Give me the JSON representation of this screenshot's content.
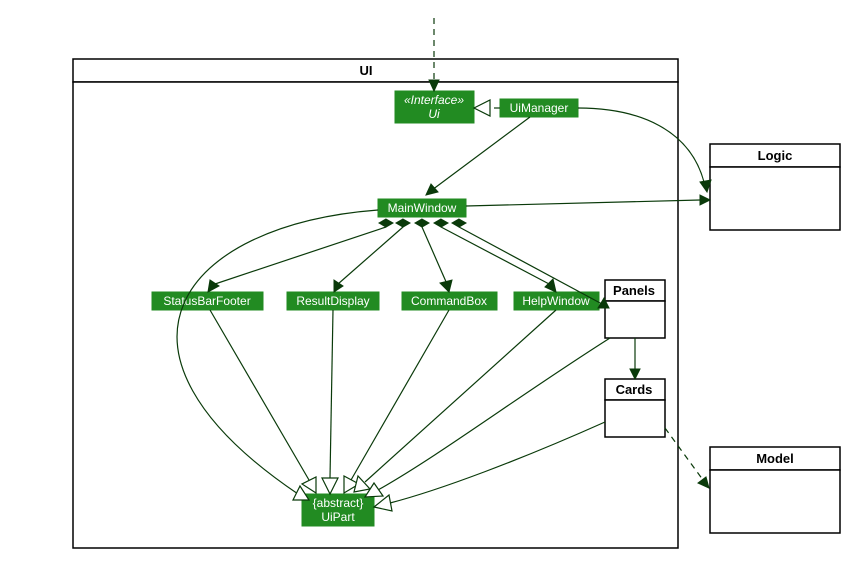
{
  "diagram": {
    "type": "uml-class",
    "packages": {
      "ui": {
        "label": "UI"
      },
      "logic": {
        "label": "Logic"
      },
      "panels": {
        "label": "Panels"
      },
      "cards": {
        "label": "Cards"
      },
      "model": {
        "label": "Model"
      }
    },
    "nodes": {
      "ui_iface": {
        "stereotype": "«Interface»",
        "name": "Ui"
      },
      "uimanager": {
        "name": "UiManager"
      },
      "mainwindow": {
        "name": "MainWindow"
      },
      "statusbarfooter": {
        "name": "StatusBarFooter"
      },
      "resultdisplay": {
        "name": "ResultDisplay"
      },
      "commandbox": {
        "name": "CommandBox"
      },
      "helpwindow": {
        "name": "HelpWindow"
      },
      "uipart": {
        "stereotype": "{abstract}",
        "name": "UiPart"
      }
    },
    "edges": [
      {
        "from": "external",
        "to": "ui_iface",
        "kind": "dependency"
      },
      {
        "from": "uimanager",
        "to": "ui_iface",
        "kind": "realization"
      },
      {
        "from": "uimanager",
        "to": "mainwindow",
        "kind": "association"
      },
      {
        "from": "uimanager",
        "to": "logic",
        "kind": "association"
      },
      {
        "from": "mainwindow",
        "to": "logic",
        "kind": "association"
      },
      {
        "from": "mainwindow",
        "to": "statusbarfooter",
        "kind": "composition"
      },
      {
        "from": "mainwindow",
        "to": "resultdisplay",
        "kind": "composition"
      },
      {
        "from": "mainwindow",
        "to": "commandbox",
        "kind": "composition"
      },
      {
        "from": "mainwindow",
        "to": "helpwindow",
        "kind": "composition"
      },
      {
        "from": "mainwindow",
        "to": "panels",
        "kind": "composition"
      },
      {
        "from": "panels",
        "to": "cards",
        "kind": "association"
      },
      {
        "from": "cards",
        "to": "model",
        "kind": "dependency"
      },
      {
        "from": "mainwindow",
        "to": "uipart",
        "kind": "generalization"
      },
      {
        "from": "statusbarfooter",
        "to": "uipart",
        "kind": "generalization"
      },
      {
        "from": "resultdisplay",
        "to": "uipart",
        "kind": "generalization"
      },
      {
        "from": "commandbox",
        "to": "uipart",
        "kind": "generalization"
      },
      {
        "from": "helpwindow",
        "to": "uipart",
        "kind": "generalization"
      },
      {
        "from": "panels",
        "to": "uipart",
        "kind": "generalization"
      },
      {
        "from": "cards",
        "to": "uipart",
        "kind": "generalization"
      }
    ]
  }
}
